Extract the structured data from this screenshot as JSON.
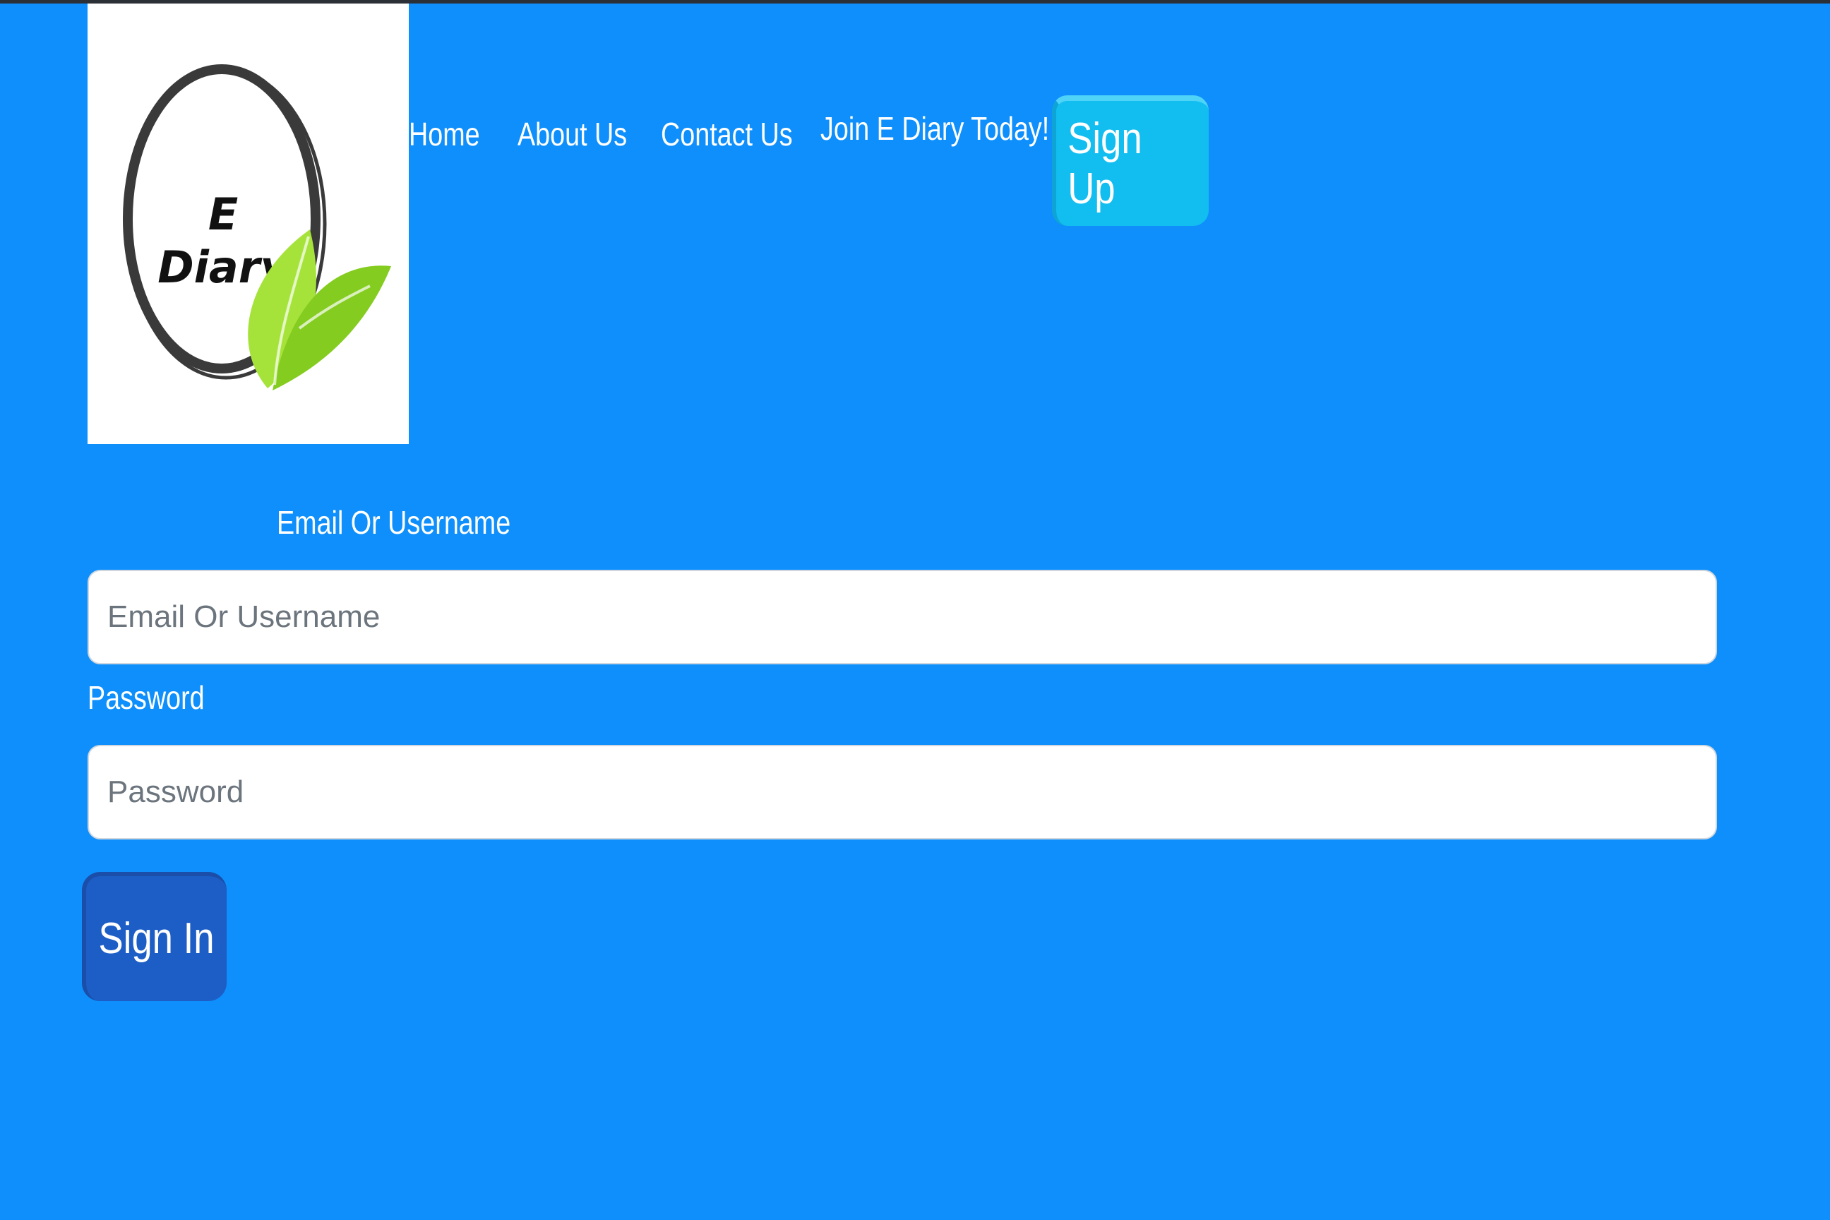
{
  "brand": {
    "logo_text_line1": "E",
    "logo_text_line2": "Diary",
    "icon": "leaf-ring-logo"
  },
  "nav": {
    "items": [
      {
        "label": "Home"
      },
      {
        "label": "About Us"
      },
      {
        "label": "Contact Us"
      },
      {
        "label": "Join E Diary Today!"
      }
    ],
    "signup_label": "Sign Up"
  },
  "form": {
    "email_label": "Email Or Username",
    "email_placeholder": "Email Or Username",
    "email_value": "",
    "password_label": "Password",
    "password_placeholder": "Password",
    "password_value": "",
    "signin_label": "Sign In"
  },
  "colors": {
    "background": "#0e8ffc",
    "signup_button": "#12bdf0",
    "signin_button": "#1d5ec6",
    "leaf": "#8fd62a"
  }
}
